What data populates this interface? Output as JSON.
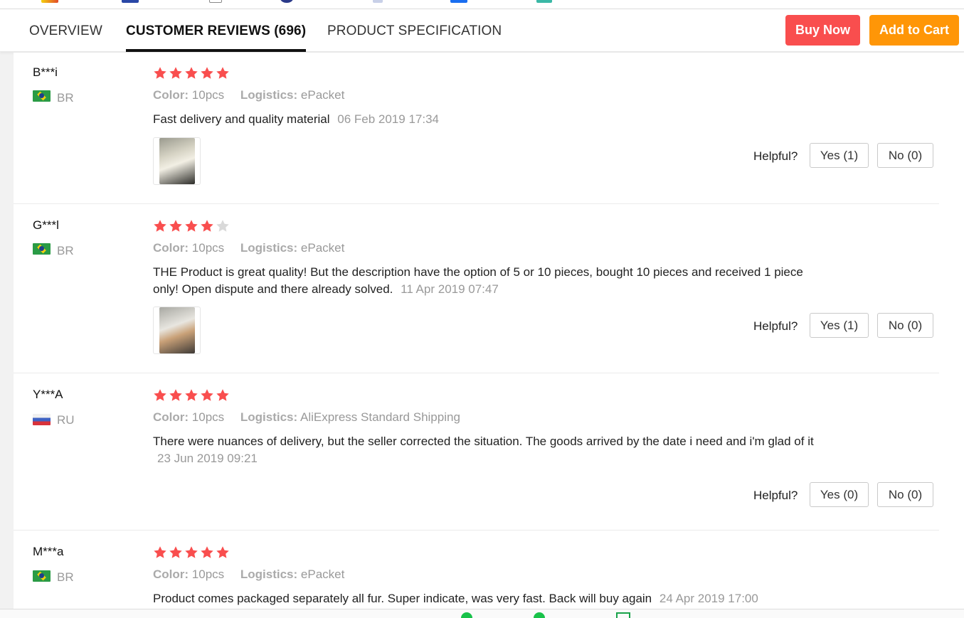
{
  "tabs": [
    {
      "label": "OVERVIEW"
    },
    {
      "label": "CUSTOMER REVIEWS (696)"
    },
    {
      "label": "PRODUCT SPECIFICATION"
    }
  ],
  "actions": {
    "buy_now": "Buy Now",
    "add_to_cart": "Add to Cart"
  },
  "labels": {
    "color_key": "Color:",
    "logistics_key": "Logistics:",
    "helpful": "Helpful?"
  },
  "colors": {
    "buy_now": "#f94e4e",
    "add_to_cart": "#ff9607",
    "star_filled": "#f94e4e",
    "star_empty": "#d9d9d9"
  },
  "reviews": [
    {
      "user": "B***i",
      "country": "BR",
      "flag_icon": "flag-br-icon",
      "rating": 5,
      "color": "10pcs",
      "logistics": "ePacket",
      "text": "Fast delivery and quality material",
      "date": "06 Feb 2019 17:34",
      "yes": "Yes (1)",
      "no": "No (0)"
    },
    {
      "user": "G***l",
      "country": "BR",
      "flag_icon": "flag-br-icon",
      "rating": 4,
      "color": "10pcs",
      "logistics": "ePacket",
      "text": "THE Product is great quality! But the description have the option of 5 or 10 pieces, bought 10 pieces and received 1 piece only! Open dispute and there already solved.",
      "date": "11 Apr 2019 07:47",
      "yes": "Yes (1)",
      "no": "No (0)"
    },
    {
      "user": "Y***A",
      "country": "RU",
      "flag_icon": "flag-ru-icon",
      "rating": 5,
      "color": "10pcs",
      "logistics": "AliExpress Standard Shipping",
      "text": "There were nuances of delivery, but the seller corrected the situation. The goods arrived by the date i need and i'm glad of it",
      "date": "23 Jun 2019 09:21",
      "yes": "Yes (0)",
      "no": "No (0)"
    },
    {
      "user": "M***a",
      "country": "BR",
      "flag_icon": "flag-br-icon",
      "rating": 5,
      "color": "10pcs",
      "logistics": "ePacket",
      "text": "Product comes packaged separately all fur. Super indicate, was very fast. Back will buy again",
      "date": "24 Apr 2019 17:00"
    }
  ]
}
